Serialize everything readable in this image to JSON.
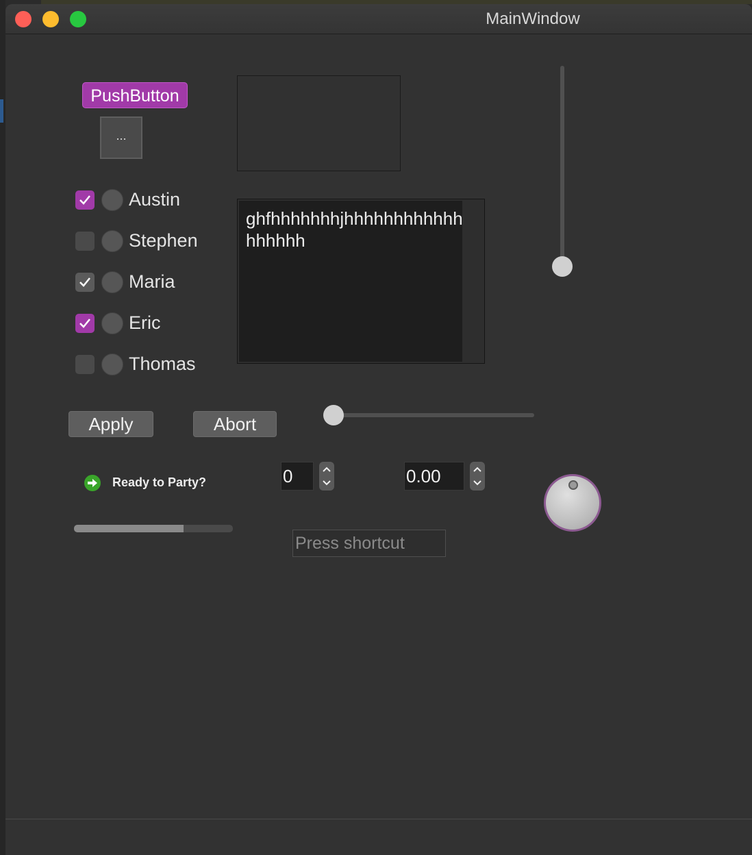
{
  "window": {
    "title": "MainWindow"
  },
  "push_button": {
    "label": "PushButton",
    "color": "#a13aa8"
  },
  "tool_button": {
    "label": "..."
  },
  "list": [
    {
      "label": "Austin",
      "checked": true,
      "check_style": "purple"
    },
    {
      "label": "Stephen",
      "checked": false,
      "check_style": "off"
    },
    {
      "label": "Maria",
      "checked": true,
      "check_style": "gray"
    },
    {
      "label": "Eric",
      "checked": true,
      "check_style": "purple"
    },
    {
      "label": "Thomas",
      "checked": false,
      "check_style": "off"
    }
  ],
  "text_edit": {
    "content": "ghfhhhhhhhjhhhhhhhhhhhhhhhhhh"
  },
  "buttons": {
    "apply": "Apply",
    "abort": "Abort"
  },
  "vertical_slider": {
    "value": 0.0
  },
  "horizontal_slider": {
    "value": 0.0
  },
  "ready": {
    "label": "Ready to Party?",
    "icon": "arrow-right-icon"
  },
  "spin_int": {
    "value": "0"
  },
  "spin_double": {
    "value": "0.00"
  },
  "progress": {
    "value": 0.69
  },
  "key_sequence": {
    "placeholder": "Press shortcut"
  },
  "colors": {
    "accent": "#a13aa8",
    "close": "#fe5f57",
    "minimize": "#febc2e",
    "maximize": "#28c840",
    "ready_icon": "#3aa52a"
  }
}
